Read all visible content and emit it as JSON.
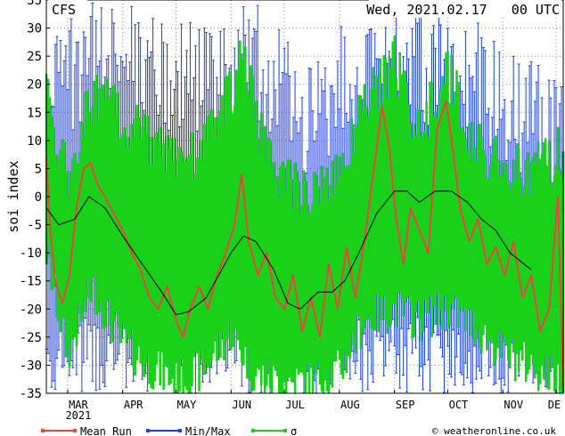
{
  "header": {
    "model": "CFS",
    "datetime": "Wed, 2021.02.17   00 UTC"
  },
  "credit": "© weatheronline.co.uk",
  "colors": {
    "mean_run": "#e8463a",
    "minmax": "#1f3fe0",
    "sigma": "#19d119",
    "smooth": "#000000",
    "grid": "#8a8aa8"
  },
  "chart_data": {
    "type": "line",
    "title": "",
    "xlabel": "",
    "ylabel": "soi index",
    "ylim": [
      -35,
      35
    ],
    "yticks": [
      -35,
      -30,
      -25,
      -20,
      -15,
      -10,
      -5,
      0,
      5,
      10,
      15,
      20,
      25,
      30,
      35
    ],
    "xlim": [
      "2021-02-17",
      "2021-12-05"
    ],
    "xticks": [
      {
        "date": "2021-03-01",
        "label": "MAR",
        "sub": "2021"
      },
      {
        "date": "2021-04-01",
        "label": "APR"
      },
      {
        "date": "2021-05-01",
        "label": "MAY"
      },
      {
        "date": "2021-06-01",
        "label": "JUN"
      },
      {
        "date": "2021-07-01",
        "label": "JUL"
      },
      {
        "date": "2021-08-01",
        "label": "AUG"
      },
      {
        "date": "2021-09-01",
        "label": "SEP"
      },
      {
        "date": "2021-10-01",
        "label": "OCT"
      },
      {
        "date": "2021-11-01",
        "label": "NOV"
      },
      {
        "date": "2021-12-01",
        "label": "DE"
      }
    ],
    "grid": true,
    "legend_position": "bottom",
    "legend": [
      {
        "label": "Mean Run",
        "color_key": "mean_run"
      },
      {
        "label": "Min/Max",
        "color_key": "minmax"
      },
      {
        "label": "σ",
        "color_key": "sigma"
      }
    ],
    "smooth_series": [
      {
        "x": "2021-02-17",
        "y": -2
      },
      {
        "x": "2021-02-24",
        "y": -5
      },
      {
        "x": "2021-03-05",
        "y": -4
      },
      {
        "x": "2021-03-13",
        "y": 0
      },
      {
        "x": "2021-03-22",
        "y": -2
      },
      {
        "x": "2021-04-01",
        "y": -7
      },
      {
        "x": "2021-04-12",
        "y": -12
      },
      {
        "x": "2021-04-23",
        "y": -17
      },
      {
        "x": "2021-05-01",
        "y": -21
      },
      {
        "x": "2021-05-08",
        "y": -20.5
      },
      {
        "x": "2021-05-18",
        "y": -18
      },
      {
        "x": "2021-06-01",
        "y": -10
      },
      {
        "x": "2021-06-08",
        "y": -7
      },
      {
        "x": "2021-06-15",
        "y": -8
      },
      {
        "x": "2021-06-25",
        "y": -13
      },
      {
        "x": "2021-07-03",
        "y": -19
      },
      {
        "x": "2021-07-10",
        "y": -20
      },
      {
        "x": "2021-07-20",
        "y": -17
      },
      {
        "x": "2021-07-28",
        "y": -17
      },
      {
        "x": "2021-08-04",
        "y": -15
      },
      {
        "x": "2021-08-12",
        "y": -10
      },
      {
        "x": "2021-08-22",
        "y": -3
      },
      {
        "x": "2021-09-01",
        "y": 1
      },
      {
        "x": "2021-09-08",
        "y": 1
      },
      {
        "x": "2021-09-15",
        "y": -1
      },
      {
        "x": "2021-09-24",
        "y": 1
      },
      {
        "x": "2021-10-03",
        "y": 1
      },
      {
        "x": "2021-10-12",
        "y": -1
      },
      {
        "x": "2021-10-20",
        "y": -4
      },
      {
        "x": "2021-10-28",
        "y": -6
      },
      {
        "x": "2021-11-05",
        "y": -10
      },
      {
        "x": "2021-11-13",
        "y": -12
      },
      {
        "x": "2021-11-17",
        "y": -13
      }
    ],
    "mean_series": [
      {
        "x": "2021-02-17",
        "y": 7
      },
      {
        "x": "2021-02-19",
        "y": -5
      },
      {
        "x": "2021-02-22",
        "y": -15
      },
      {
        "x": "2021-02-26",
        "y": -19
      },
      {
        "x": "2021-03-02",
        "y": -14
      },
      {
        "x": "2021-03-06",
        "y": -2
      },
      {
        "x": "2021-03-10",
        "y": 5
      },
      {
        "x": "2021-03-14",
        "y": 6
      },
      {
        "x": "2021-03-18",
        "y": 2
      },
      {
        "x": "2021-03-22",
        "y": 0
      },
      {
        "x": "2021-03-27",
        "y": -3
      },
      {
        "x": "2021-04-01",
        "y": -6
      },
      {
        "x": "2021-04-06",
        "y": -10
      },
      {
        "x": "2021-04-11",
        "y": -13
      },
      {
        "x": "2021-04-16",
        "y": -18
      },
      {
        "x": "2021-04-21",
        "y": -20
      },
      {
        "x": "2021-04-26",
        "y": -16
      },
      {
        "x": "2021-05-01",
        "y": -22
      },
      {
        "x": "2021-05-05",
        "y": -25
      },
      {
        "x": "2021-05-09",
        "y": -20
      },
      {
        "x": "2021-05-14",
        "y": -16
      },
      {
        "x": "2021-05-19",
        "y": -20
      },
      {
        "x": "2021-05-24",
        "y": -14
      },
      {
        "x": "2021-05-29",
        "y": -10
      },
      {
        "x": "2021-06-03",
        "y": -5
      },
      {
        "x": "2021-06-07",
        "y": 4
      },
      {
        "x": "2021-06-11",
        "y": -8
      },
      {
        "x": "2021-06-16",
        "y": -14
      },
      {
        "x": "2021-06-21",
        "y": -10
      },
      {
        "x": "2021-06-26",
        "y": -18
      },
      {
        "x": "2021-07-01",
        "y": -20
      },
      {
        "x": "2021-07-06",
        "y": -14
      },
      {
        "x": "2021-07-11",
        "y": -24
      },
      {
        "x": "2021-07-16",
        "y": -18
      },
      {
        "x": "2021-07-21",
        "y": -25
      },
      {
        "x": "2021-07-26",
        "y": -12
      },
      {
        "x": "2021-07-31",
        "y": -20
      },
      {
        "x": "2021-08-05",
        "y": -9
      },
      {
        "x": "2021-08-10",
        "y": -18
      },
      {
        "x": "2021-08-15",
        "y": -8
      },
      {
        "x": "2021-08-20",
        "y": 4
      },
      {
        "x": "2021-08-25",
        "y": 16
      },
      {
        "x": "2021-08-29",
        "y": 9
      },
      {
        "x": "2021-09-02",
        "y": -4
      },
      {
        "x": "2021-09-06",
        "y": -12
      },
      {
        "x": "2021-09-10",
        "y": -2
      },
      {
        "x": "2021-09-15",
        "y": -6
      },
      {
        "x": "2021-09-20",
        "y": -10
      },
      {
        "x": "2021-09-25",
        "y": 12
      },
      {
        "x": "2021-09-30",
        "y": 17
      },
      {
        "x": "2021-10-04",
        "y": 8
      },
      {
        "x": "2021-10-08",
        "y": -2
      },
      {
        "x": "2021-10-13",
        "y": -8
      },
      {
        "x": "2021-10-18",
        "y": -4
      },
      {
        "x": "2021-10-23",
        "y": -12
      },
      {
        "x": "2021-10-28",
        "y": -9
      },
      {
        "x": "2021-11-02",
        "y": -14
      },
      {
        "x": "2021-11-07",
        "y": -8
      },
      {
        "x": "2021-11-12",
        "y": -18
      },
      {
        "x": "2021-11-17",
        "y": -14
      },
      {
        "x": "2021-11-22",
        "y": -24
      },
      {
        "x": "2021-11-27",
        "y": -20
      },
      {
        "x": "2021-12-02",
        "y": 0
      },
      {
        "x": "2021-12-05",
        "y": -35
      }
    ],
    "sigma_bands": [
      {
        "x": "2021-02-17",
        "lo": -12,
        "hi": 20
      },
      {
        "x": "2021-03-01",
        "lo": -30,
        "hi": 5
      },
      {
        "x": "2021-03-15",
        "lo": -18,
        "hi": 20
      },
      {
        "x": "2021-04-01",
        "lo": -28,
        "hi": 16
      },
      {
        "x": "2021-04-15",
        "lo": -32,
        "hi": 12
      },
      {
        "x": "2021-05-01",
        "lo": -35,
        "hi": 8
      },
      {
        "x": "2021-05-15",
        "lo": -33,
        "hi": 10
      },
      {
        "x": "2021-06-01",
        "lo": -26,
        "hi": 20
      },
      {
        "x": "2021-06-08",
        "lo": -30,
        "hi": 28
      },
      {
        "x": "2021-06-15",
        "lo": -34,
        "hi": 15
      },
      {
        "x": "2021-07-01",
        "lo": -35,
        "hi": 5
      },
      {
        "x": "2021-07-15",
        "lo": -35,
        "hi": 2
      },
      {
        "x": "2021-08-01",
        "lo": -33,
        "hi": 6
      },
      {
        "x": "2021-08-15",
        "lo": -24,
        "hi": 18
      },
      {
        "x": "2021-09-01",
        "lo": -22,
        "hi": 26
      },
      {
        "x": "2021-09-15",
        "lo": -24,
        "hi": 14
      },
      {
        "x": "2021-10-01",
        "lo": -22,
        "hi": 24
      },
      {
        "x": "2021-10-15",
        "lo": -25,
        "hi": 12
      },
      {
        "x": "2021-11-01",
        "lo": -30,
        "hi": 8
      },
      {
        "x": "2021-11-15",
        "lo": -32,
        "hi": 6
      },
      {
        "x": "2021-12-05",
        "lo": -35,
        "hi": 10
      }
    ],
    "minmax_bands": [
      {
        "x": "2021-02-17",
        "lo": -35,
        "hi": 30
      },
      {
        "x": "2021-03-15",
        "lo": -35,
        "hi": 35
      },
      {
        "x": "2021-04-15",
        "lo": -35,
        "hi": 35
      },
      {
        "x": "2021-05-15",
        "lo": -35,
        "hi": 30
      },
      {
        "x": "2021-06-15",
        "lo": -35,
        "hi": 35
      },
      {
        "x": "2021-07-15",
        "lo": -35,
        "hi": 25
      },
      {
        "x": "2021-08-15",
        "lo": -35,
        "hi": 35
      },
      {
        "x": "2021-09-15",
        "lo": -35,
        "hi": 35
      },
      {
        "x": "2021-10-15",
        "lo": -35,
        "hi": 32
      },
      {
        "x": "2021-11-15",
        "lo": -35,
        "hi": 25
      },
      {
        "x": "2021-12-05",
        "lo": -35,
        "hi": 20
      }
    ]
  }
}
